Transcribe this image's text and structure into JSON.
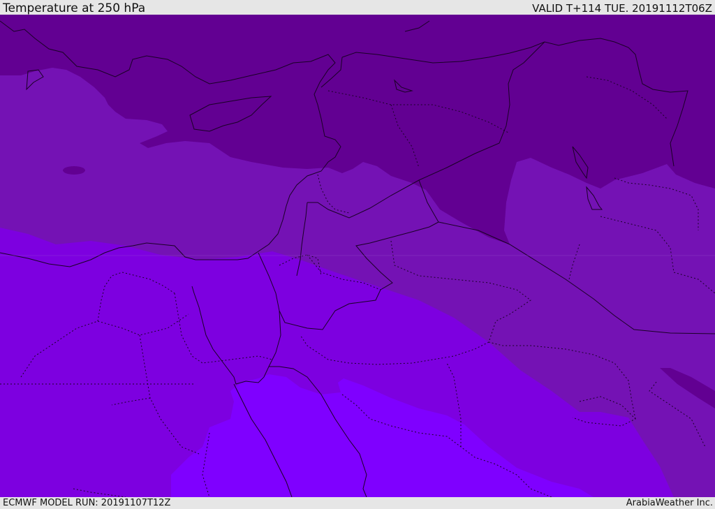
{
  "header": {
    "title": "Temperature at 250 hPa",
    "valid_time": "VALID T+114 TUE. 20191112T06Z"
  },
  "footer": {
    "model_run": "ECMWF MODEL RUN: 20191107T12Z",
    "provider": "ArabiaWeather Inc."
  },
  "colors": {
    "coldest": "#620092",
    "cold": "#7412b4",
    "mild": "#7d00e0",
    "warm": "#7f00ff",
    "borders": "#1a0026"
  }
}
